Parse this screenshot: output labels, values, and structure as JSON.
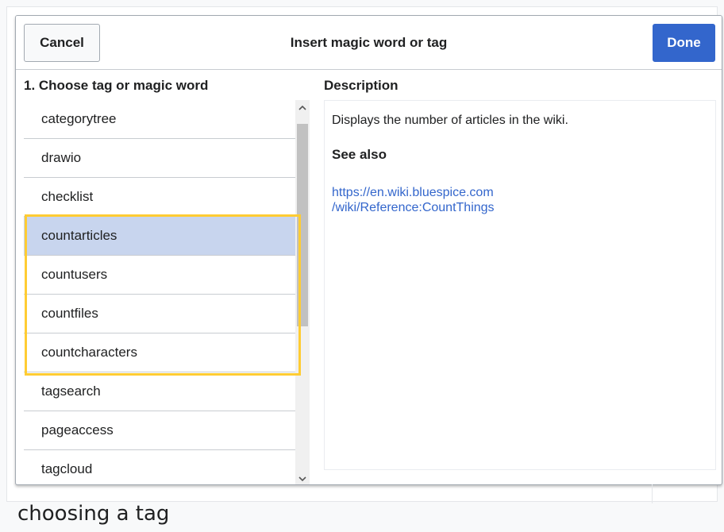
{
  "dialog": {
    "title": "Insert magic word or tag",
    "cancel_label": "Cancel",
    "done_label": "Done"
  },
  "list": {
    "heading": "1. Choose tag or magic word",
    "items": [
      {
        "label": "categorytree"
      },
      {
        "label": "drawio"
      },
      {
        "label": "checklist"
      },
      {
        "label": "countarticles"
      },
      {
        "label": "countusers"
      },
      {
        "label": "countfiles"
      },
      {
        "label": "countcharacters"
      },
      {
        "label": "tagsearch"
      },
      {
        "label": "pageaccess"
      },
      {
        "label": "tagcloud"
      }
    ],
    "selected_index": 3
  },
  "description": {
    "heading": "Description",
    "text": "Displays the number of articles in the wiki.",
    "see_also_heading": "See also",
    "link_line1": "https://en.wiki.bluespice.com",
    "link_line2": "/wiki/Reference:CountThings"
  },
  "caption": "choosing a tag",
  "icons": {
    "scroll_up": "chevron-up-icon",
    "scroll_down": "chevron-down-icon"
  },
  "colors": {
    "accent": "#3366cc",
    "selected_row": "#c8d5ee",
    "highlight": "#ffcc33"
  }
}
